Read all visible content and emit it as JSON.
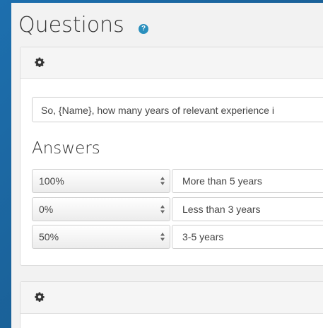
{
  "header": {
    "title": "Questions",
    "help_icon": "question-circle-icon",
    "help_glyph": "?",
    "accent_color": "#2a8fbd"
  },
  "questions": [
    {
      "settings_icon": "gear-icon",
      "question_text": "So, {Name}, how many years of relevant experience i",
      "answers_title": "Answers",
      "answers": [
        {
          "score": "100%",
          "text": "More than 5 years"
        },
        {
          "score": "0%",
          "text": "Less than 3 years"
        },
        {
          "score": "50%",
          "text": "3-5 years"
        }
      ]
    },
    {
      "settings_icon": "gear-icon"
    }
  ]
}
